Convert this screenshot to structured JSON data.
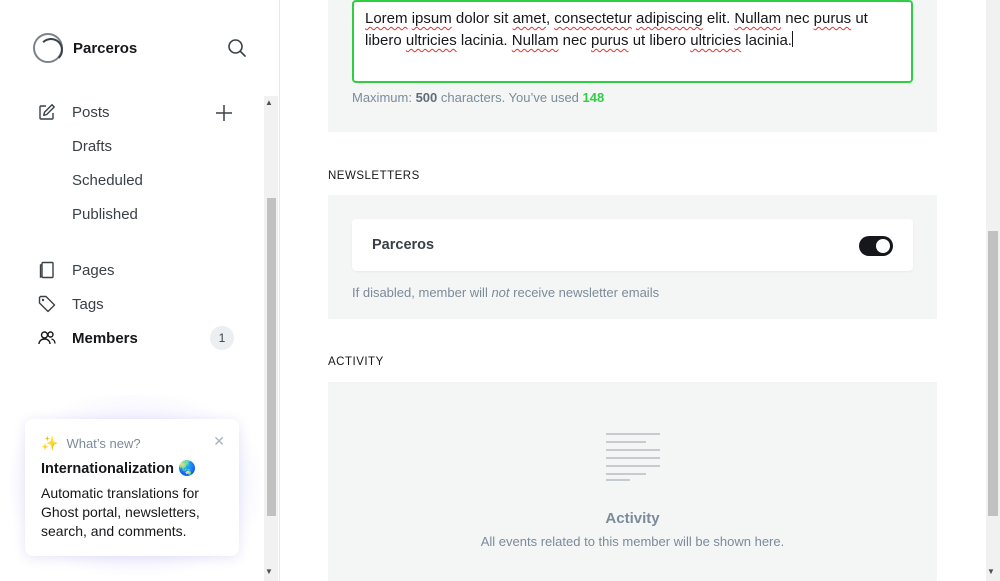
{
  "brand": {
    "name": "Parceros"
  },
  "nav": {
    "posts": "Posts",
    "drafts": "Drafts",
    "scheduled": "Scheduled",
    "published": "Published",
    "pages": "Pages",
    "tags": "Tags",
    "members": "Members",
    "members_count": "1"
  },
  "whats_new": {
    "header": "What’s new?",
    "title": "Internationalization 🌏",
    "body": "Automatic translations for Ghost portal, newsletters, search, and comments."
  },
  "note": {
    "text_part1": "Lorem ipsum dolor sit amet, consectetur adipiscing elit. Nullam nec purus ut libero ultricies lacinia. Nullam nec purus ut libero ultricies lacinia.",
    "hint_prefix": "Maximum: ",
    "max": "500",
    "hint_mid": " characters. You’ve used ",
    "used": "148"
  },
  "newsletters": {
    "section_title": "NEWSLETTERS",
    "name": "Parceros",
    "enabled": true,
    "hint_prefix": "If disabled, member will ",
    "hint_em": "not",
    "hint_suffix": " receive newsletter emails"
  },
  "activity": {
    "section_title": "ACTIVITY",
    "title": "Activity",
    "description": "All events related to this member will be shown here."
  },
  "colors": {
    "accent_green": "#30cf43",
    "toggle_on": "#15171a"
  }
}
